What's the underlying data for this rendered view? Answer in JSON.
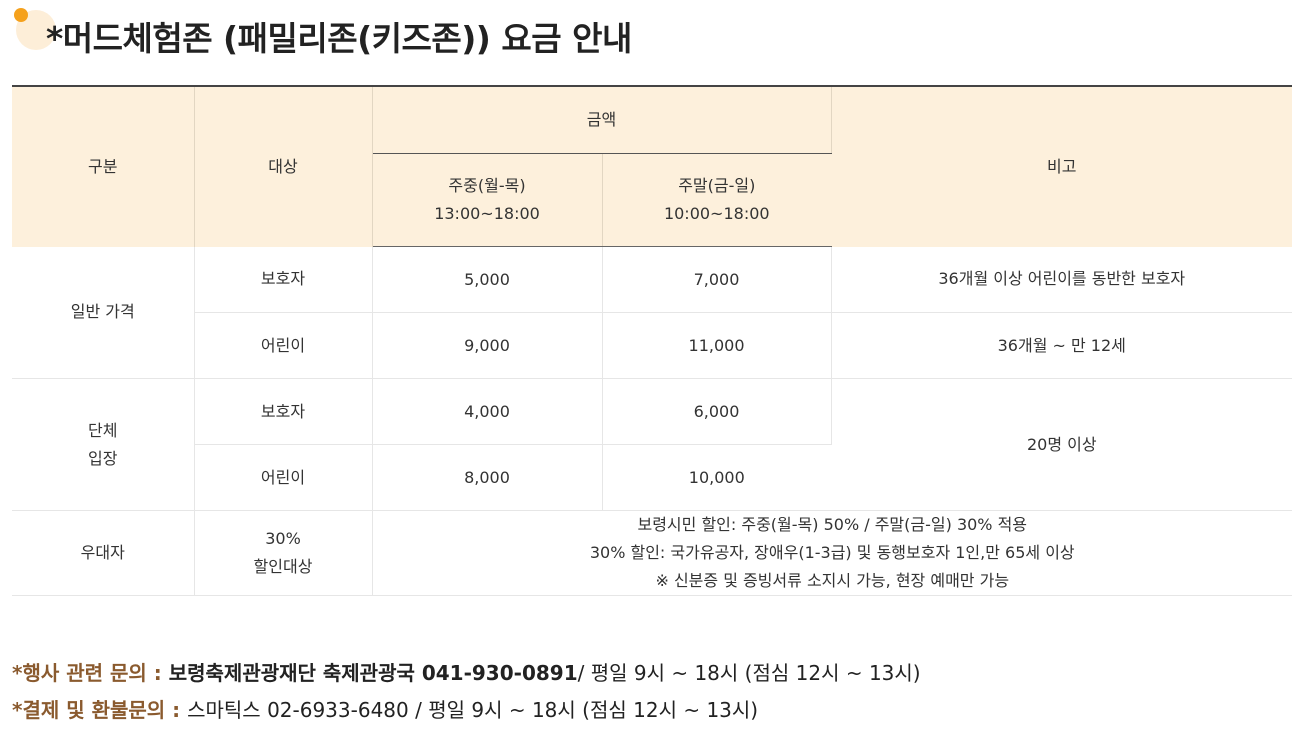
{
  "title": "*머드체험존 (패밀리존(키즈존)) 요금 안내",
  "table": {
    "headers": {
      "category": "구분",
      "target": "대상",
      "amount": "금액",
      "weekday_line1": "주중(월-목)",
      "weekday_line2": "13:00~18:00",
      "weekend_line1": "주말(금-일)",
      "weekend_line2": "10:00~18:00",
      "remarks": "비고"
    },
    "general": {
      "category": "일반 가격",
      "rows": [
        {
          "target": "보호자",
          "weekday": "5,000",
          "weekend": "7,000",
          "remark": "36개월 이상 어린이를 동반한 보호자"
        },
        {
          "target": "어린이",
          "weekday": "9,000",
          "weekend": "11,000",
          "remark": "36개월 ~ 만 12세"
        }
      ]
    },
    "group": {
      "category_line1": "단체",
      "category_line2": "입장",
      "rows": [
        {
          "target": "보호자",
          "weekday": "4,000",
          "weekend": "6,000"
        },
        {
          "target": "어린이",
          "weekday": "8,000",
          "weekend": "10,000"
        }
      ],
      "remark": "20명 이상"
    },
    "preferential": {
      "category": "우대자",
      "target_line1": "30%",
      "target_line2": "할인대상",
      "notes": [
        "보령시민 할인: 주중(월-목) 50% / 주말(금-일) 30% 적용",
        "30% 할인: 국가유공자, 장애우(1-3급) 및 동행보호자 1인,만 65세 이상",
        "※ 신분증 및 증빙서류 소지시 가능, 현장 예매만 가능"
      ]
    }
  },
  "inquiries": [
    {
      "label": "*행사 관련 문의 : ",
      "org": "보령축제관광재단 축제관광국 041-930-0891",
      "detail": "/ 평일 9시 ~ 18시 (점심 12시 ~ 13시)"
    },
    {
      "label": "*결제 및 환불문의 : ",
      "org": "",
      "detail": "스마틱스 02-6933-6480 / 평일 9시 ~ 18시 (점심 12시 ~ 13시)"
    }
  ],
  "colors": {
    "accent": "#f5a11c",
    "header_bg": "#fdf0dc",
    "price": "#1b56a6",
    "label": "#8a5a2e"
  }
}
